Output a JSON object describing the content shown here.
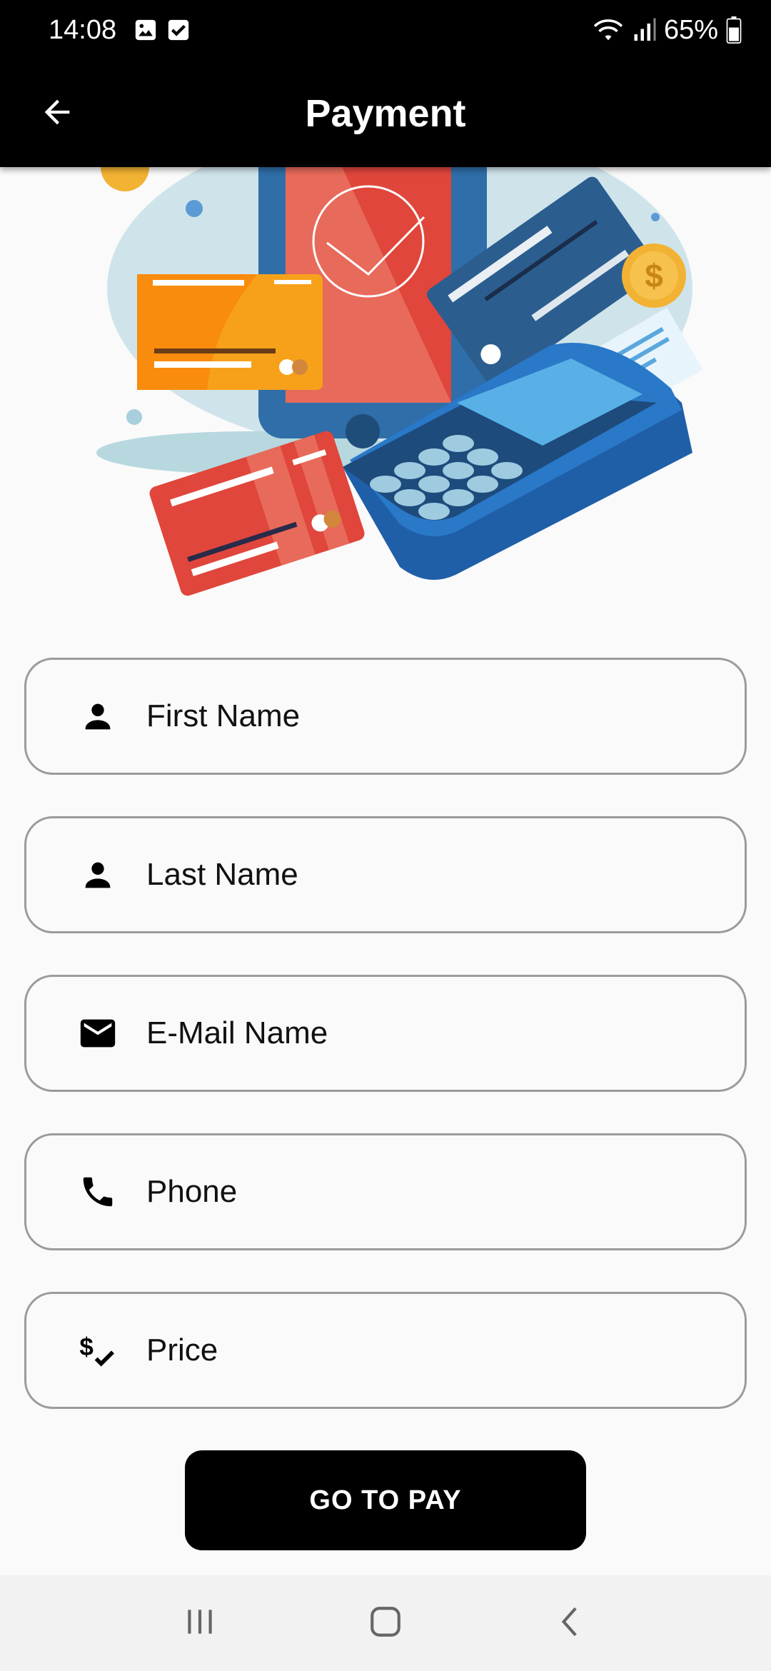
{
  "status_bar": {
    "time": "14:08",
    "battery": "65%",
    "icons": [
      "gallery-icon",
      "checkbox-icon",
      "wifi-icon",
      "signal-icon",
      "battery-icon"
    ]
  },
  "app_bar": {
    "title": "Payment",
    "back_icon": "arrow-left-icon"
  },
  "form": {
    "fields": [
      {
        "label": "First Name",
        "icon": "person-icon"
      },
      {
        "label": "Last Name",
        "icon": "person-icon"
      },
      {
        "label": "E-Mail Name",
        "icon": "mail-icon"
      },
      {
        "label": "Phone",
        "icon": "phone-icon"
      },
      {
        "label": "Price",
        "icon": "price-check-icon"
      }
    ],
    "submit_label": "GO TO PAY"
  },
  "nav_bar": {
    "icons": [
      "recent-apps-icon",
      "home-icon",
      "back-icon"
    ]
  },
  "colors": {
    "app_bar": "#000000",
    "background": "#fafafa",
    "field_border": "#9b9b9b",
    "button": "#000000"
  }
}
